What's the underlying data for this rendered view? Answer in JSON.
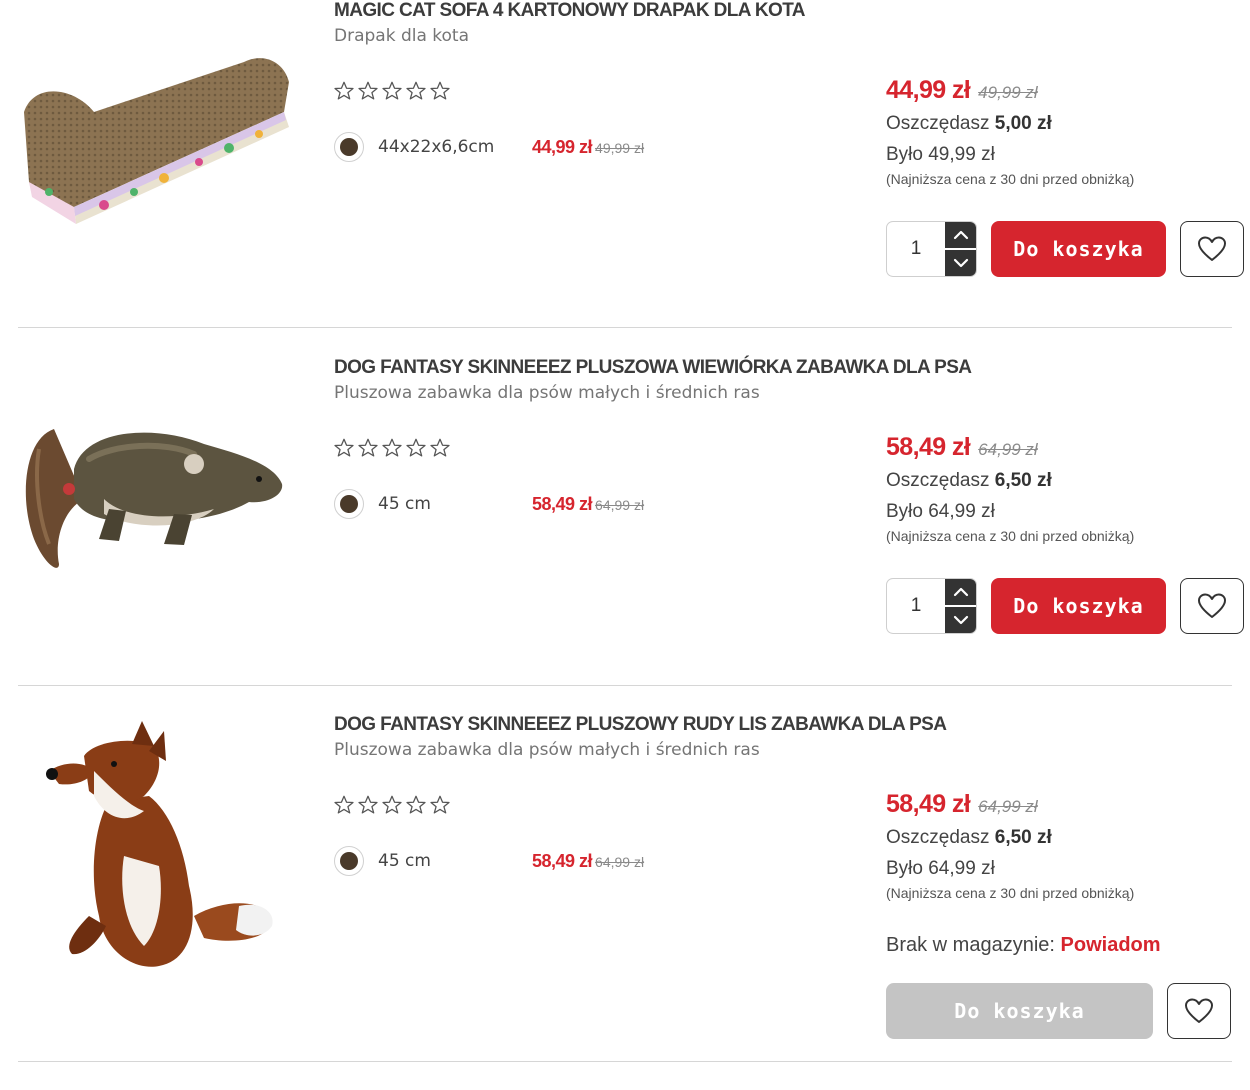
{
  "colors": {
    "accent": "#d6252e",
    "text": "#333333",
    "muted": "#757575",
    "disabled": "#c4c4c4"
  },
  "products": [
    {
      "title": "MAGIC CAT SOFA 4 KARTONOWY DRAPAK DLA KOTA",
      "subtitle": "Drapak dla kota",
      "rating_stars": 0,
      "image": "cardboard-cat-scratcher",
      "variant": {
        "label": "44x22x6,6cm",
        "price": "44,99 zł",
        "old_price": "49,99 zł"
      },
      "price": "44,99 zł",
      "old_price": "49,99 zł",
      "save_label": "Oszczędasz",
      "save_value": "5,00 zł",
      "was": "Było 49,99 zł",
      "lowest": "(Najniższa cena z 30 dni przed obniżką)",
      "quantity": "1",
      "cart_label": "Do koszyka",
      "in_stock": true
    },
    {
      "title": "DOG FANTASY SKINNEEEZ PLUSZOWA WIEWIÓRKA ZABAWKA DLA PSA",
      "subtitle": "Pluszowa zabawka dla psów małych i średnich ras",
      "rating_stars": 0,
      "image": "plush-squirrel-toy",
      "variant": {
        "label": "45 cm",
        "price": "58,49 zł",
        "old_price": "64,99 zł"
      },
      "price": "58,49 zł",
      "old_price": "64,99 zł",
      "save_label": "Oszczędasz",
      "save_value": "6,50 zł",
      "was": "Było 64,99 zł",
      "lowest": "(Najniższa cena z 30 dni przed obniżką)",
      "quantity": "1",
      "cart_label": "Do koszyka",
      "in_stock": true
    },
    {
      "title": "DOG FANTASY SKINNEEEZ PLUSZOWY RUDY LIS ZABAWKA DLA PSA",
      "subtitle": "Pluszowa zabawka dla psów małych i średnich ras",
      "rating_stars": 0,
      "image": "plush-fox-toy",
      "variant": {
        "label": "45 cm",
        "price": "58,49 zł",
        "old_price": "64,99 zł"
      },
      "price": "58,49 zł",
      "old_price": "64,99 zł",
      "save_label": "Oszczędasz",
      "save_value": "6,50 zł",
      "was": "Było 64,99 zł",
      "lowest": "(Najniższa cena z 30 dni przed obniżką)",
      "stock_label": "Brak w magazynie:",
      "notify_label": "Powiadom",
      "cart_label": "Do koszyka",
      "in_stock": false
    }
  ]
}
